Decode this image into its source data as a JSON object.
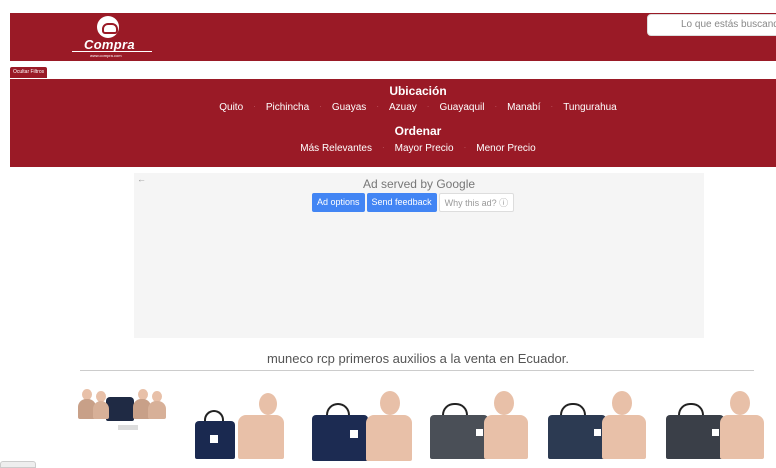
{
  "header": {
    "logo_text": "Compra",
    "logo_sub": "www.compra.com",
    "search_placeholder": "Lo que estás buscando"
  },
  "filters": {
    "toggle_label": "Ocultar Filtros",
    "location_title": "Ubicación",
    "locations": [
      "Quito",
      "Pichincha",
      "Guayas",
      "Azuay",
      "Guayaquil",
      "Manabí",
      "Tungurahua"
    ],
    "order_title": "Ordenar",
    "orders": [
      "Más Relevantes",
      "Mayor Precio",
      "Menor Precio"
    ]
  },
  "ad": {
    "served_by": "Ad served by",
    "google": "Google",
    "options_label": "Ad options",
    "feedback_label": "Send feedback",
    "why_label": "Why this ad? ⓘ",
    "back_arrow": "←"
  },
  "listing": {
    "title": "muneco rcp primeros auxilios a la venta en Ecuador."
  },
  "colors": {
    "brand": "#9a1a26",
    "ad_blue": "#4285f4"
  },
  "products": [
    {
      "name": "cpr-manikin-pack-product"
    },
    {
      "name": "cpr-manikin-ultralite-product"
    },
    {
      "name": "cpr-manikin-blue-bag-product"
    },
    {
      "name": "cpr-manikin-gray-bag-product-1"
    },
    {
      "name": "cpr-manikin-gray-bag-product-2"
    },
    {
      "name": "cpr-manikin-gray-bag-product-3"
    }
  ]
}
